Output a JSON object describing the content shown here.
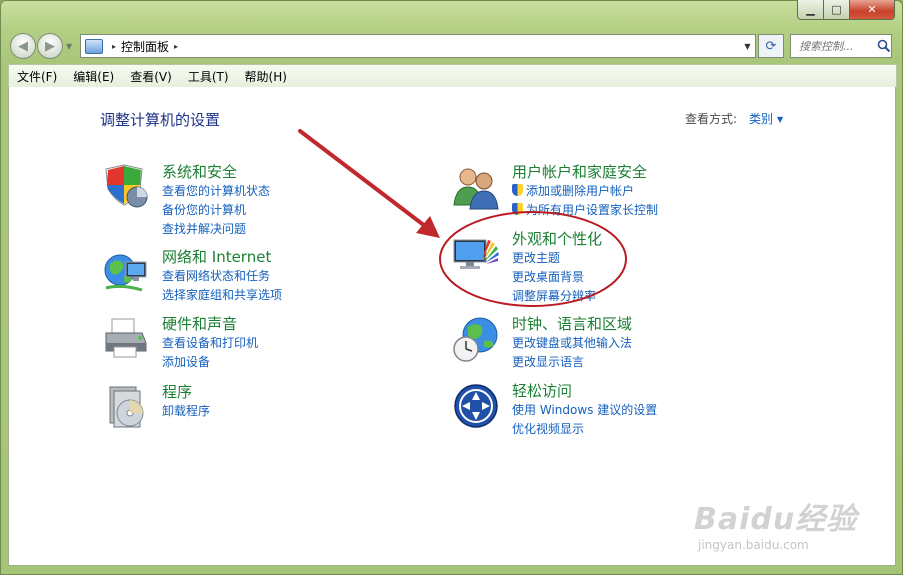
{
  "window": {
    "minimize_glyph": "▁",
    "maximize_glyph": "□",
    "close_glyph": "✕"
  },
  "nav": {
    "back_glyph": "◀",
    "forward_glyph": "▶",
    "dropdown_glyph": "▼",
    "breadcrumb": "控制面板",
    "breadcrumb_sep": "▸",
    "refresh_glyph": "⟳",
    "search_placeholder": "搜索控制...",
    "search_icon": "search-icon"
  },
  "menu": [
    "文件(F)",
    "编辑(E)",
    "查看(V)",
    "工具(T)",
    "帮助(H)"
  ],
  "main": {
    "title": "调整计算机的设置",
    "view_by_label": "查看方式:",
    "view_by_value": "类别",
    "view_by_glyph": "▼"
  },
  "categories": [
    {
      "title": "系统和安全",
      "icon": "shield-computer-icon",
      "links": [
        "查看您的计算机状态",
        "备份您的计算机",
        "查找并解决问题"
      ]
    },
    {
      "title": "网络和 Internet",
      "icon": "network-globe-icon",
      "links": [
        "查看网络状态和任务",
        "选择家庭组和共享选项"
      ]
    },
    {
      "title": "硬件和声音",
      "icon": "printer-icon",
      "links": [
        "查看设备和打印机",
        "添加设备"
      ]
    },
    {
      "title": "程序",
      "icon": "programs-disc-icon",
      "links": [
        "卸载程序"
      ]
    },
    {
      "title": "用户帐户和家庭安全",
      "icon": "users-icon",
      "links": [
        "添加或删除用户帐户",
        "为所有用户设置家长控制"
      ]
    },
    {
      "title": "外观和个性化",
      "icon": "appearance-monitor-icon",
      "links": [
        "更改主题",
        "更改桌面背景",
        "调整屏幕分辨率"
      ]
    },
    {
      "title": "时钟、语言和区域",
      "icon": "clock-globe-icon",
      "links": [
        "更改键盘或其他输入法",
        "更改显示语言"
      ]
    },
    {
      "title": "轻松访问",
      "icon": "ease-of-access-icon",
      "links": [
        "使用 Windows 建议的设置",
        "优化视频显示"
      ]
    }
  ],
  "annotation": {
    "arrow_color": "#c0282d",
    "ellipse_color": "#b81c22"
  },
  "watermark": {
    "logo": "Baidu经验",
    "sub": "jingyan.baidu.com"
  }
}
